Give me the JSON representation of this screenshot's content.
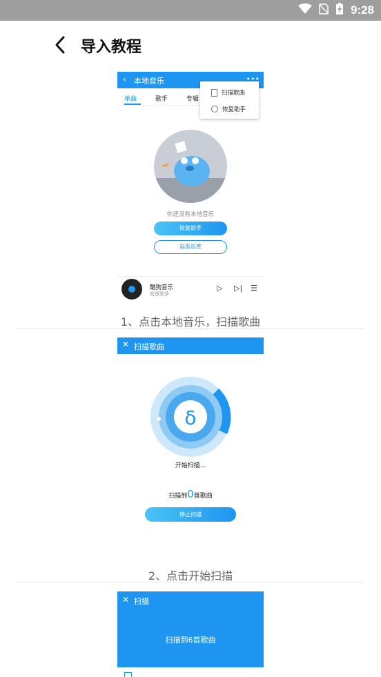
{
  "status": {
    "time": "9:28"
  },
  "header": {
    "title": "导入教程"
  },
  "step1": {
    "screen_title": "本地音乐",
    "tabs": [
      "单曲",
      "歌手",
      "专辑"
    ],
    "menu": [
      "扫描歌曲",
      "恢复助手"
    ],
    "empty_text": "你还没有本地音乐",
    "restore_button": "恢复助手",
    "browse_button": "逛逛乐库",
    "player_song": "酷狗音乐",
    "player_artist": "就是歌多",
    "caption": "1、点击本地音乐，扫描歌曲"
  },
  "step2": {
    "screen_title": "扫描歌曲",
    "scanning_text": "开始扫描...",
    "count_prefix": "扫描到",
    "count_value": "0",
    "count_suffix": "首歌曲",
    "stop_button": "停止扫描",
    "caption": "2、点击开始扫描"
  },
  "step3": {
    "screen_title": "扫描",
    "found_text": "扫描到6首歌曲"
  },
  "colors": {
    "accent": "#1e95f0",
    "statusbar": "#9e9e9e"
  }
}
